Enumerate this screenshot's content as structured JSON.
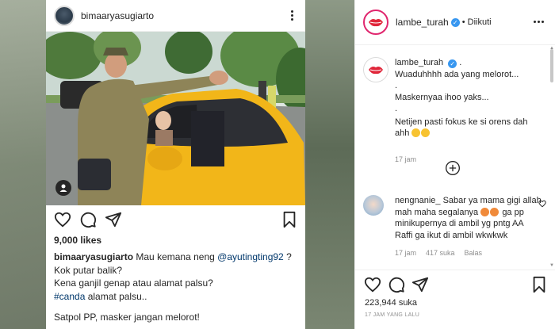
{
  "post": {
    "username": "bimaaryasugiarto",
    "likes": "9,000 likes",
    "caption_user": "bimaaryasugiarto",
    "caption_line1_text": "Mau kemana neng",
    "caption_mention": "@ayutingting92",
    "caption_line1_end": "?",
    "caption_line2": "Kok putar balik?",
    "caption_line3": "Kena ganjil genap atau alamat palsu?",
    "caption_hashtag": "#canda",
    "caption_line4_end": "alamat palsu..",
    "caption_line5": "Satpol PP, masker jangan melorot!"
  },
  "side": {
    "username": "lambe_turah",
    "follow_state": "• Diikuti",
    "caption": {
      "username": "lambe_turah",
      "suffix": ".",
      "line1": "Wuaduhhhh ada yang melorot...",
      "dot1": ".",
      "line2": "Maskernyaa ihoo yaks...",
      "dot2": ".",
      "line3": "Netijen pasti fokus ke si orens dah ahh",
      "time": "17 jam"
    },
    "comment": {
      "username": "nengnanie_",
      "text1": "Sabar ya mama gigi allah mah maha segalanya",
      "text2": "ga pp minikupernya di ambil yg pntg AA Raffi ga ikut di ambil wkwkwk",
      "time": "17 jam",
      "likes": "417 suka",
      "reply": "Balas"
    },
    "likes": "223,944 suka",
    "posted": "17 JAM YANG LALU"
  },
  "colors": {
    "verified": "#3897f0",
    "link": "#00376b",
    "muted": "#8e8e8e",
    "car_yellow": "#f2b619"
  },
  "icons": [
    "kebab-icon",
    "heart-icon",
    "comment-icon",
    "share-icon",
    "bookmark-icon",
    "tag-user-icon",
    "plus-circle-icon",
    "verified-icon",
    "more-icon"
  ]
}
